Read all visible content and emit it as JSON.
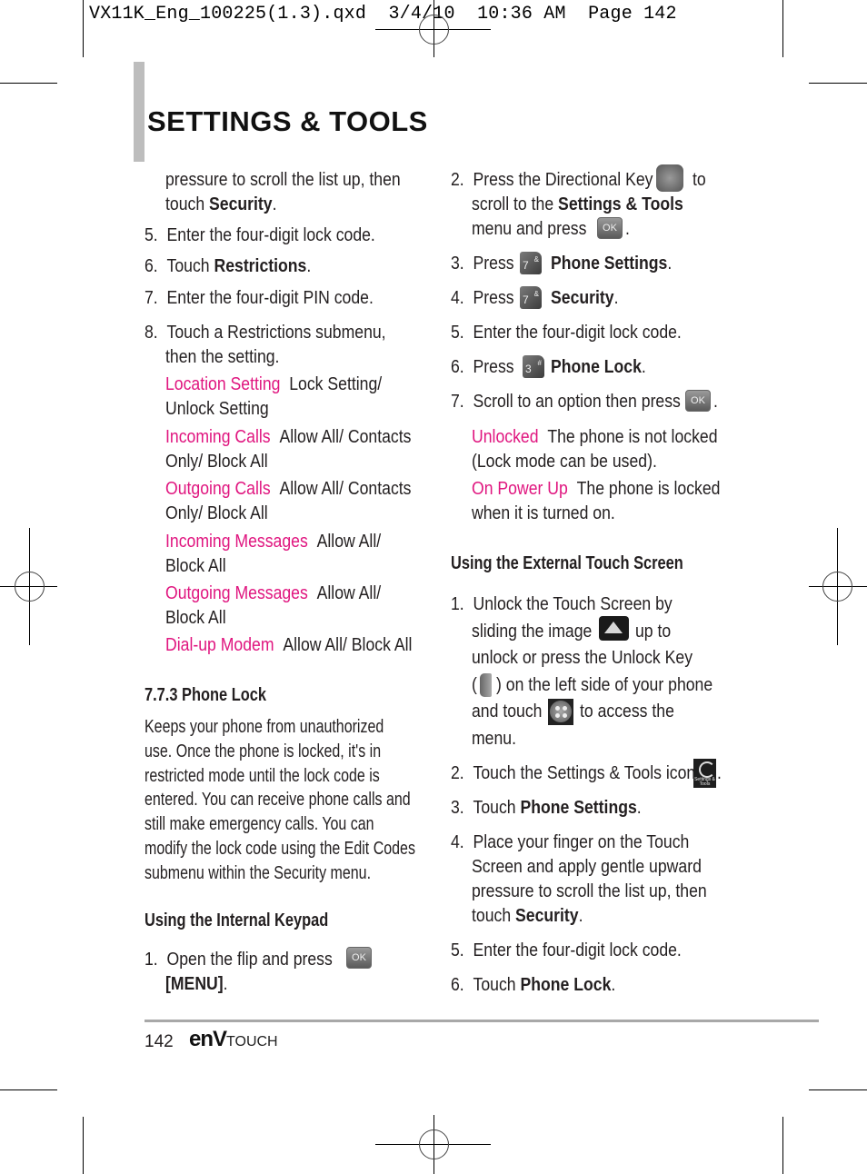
{
  "slug": "VX11K_Eng_100225(1.3).qxd  3/4/10  10:36 AM  Page 142",
  "section_title": "SETTINGS & TOOLS",
  "left": {
    "cont_line1": "pressure to scroll the list up, then",
    "cont_line2_pre": "touch ",
    "cont_line2_bold": "Security",
    "steps": [
      {
        "n": "5.",
        "text": "Enter the four-digit lock code."
      },
      {
        "n": "6.",
        "pre": "Touch ",
        "bold": "Restrictions",
        "post": "."
      },
      {
        "n": "7.",
        "text": "Enter the four-digit PIN code."
      },
      {
        "n": "8.",
        "line1": "Touch a Restrictions submenu,",
        "line2": "then the setting."
      }
    ],
    "options": [
      {
        "name": "Location Setting",
        "l1": "Lock Setting/",
        "l2": "Unlock Setting"
      },
      {
        "name": "Incoming Calls",
        "l1": "Allow All/ Contacts",
        "l2": "Only/ Block All"
      },
      {
        "name": "Outgoing Calls",
        "l1": "Allow All/ Contacts",
        "l2": "Only/ Block All"
      },
      {
        "name": "Incoming Messages",
        "l1": "Allow All/",
        "l2": "Block All"
      },
      {
        "name": "Outgoing Messages",
        "l1": "Allow All/",
        "l2": "Block All"
      },
      {
        "name": "Dial-up Modem",
        "l1": "Allow All/ Block All"
      }
    ],
    "heading_phone_lock": "7.7.3 Phone Lock",
    "phone_lock_body": [
      "Keeps your phone from unauthorized",
      "use. Once the phone is locked, it's in",
      "restricted mode until the lock code is",
      "entered. You can receive phone calls and",
      "still make emergency calls. You can",
      "modify the lock code using the Edit Codes",
      "submenu within the Security menu."
    ],
    "heading_internal": "Using the Internal Keypad",
    "step1": {
      "n": "1.",
      "text": "Open the flip and press",
      "bold": "[MENU]",
      "post": "."
    }
  },
  "right": {
    "steps_a": [
      {
        "n": "2.",
        "l1_pre": "Press the Directional Key",
        "l1_post": "to",
        "l2_pre": "scroll to the ",
        "l2_bold": "Settings & Tools",
        "l3": "menu and press",
        "l3_post": "."
      },
      {
        "n": "3.",
        "pre": "Press",
        "bold": "Phone Settings",
        "post": ".",
        "key": "7",
        "key_sup": "&"
      },
      {
        "n": "4.",
        "pre": "Press",
        "bold": "Security",
        "post": ".",
        "key": "7",
        "key_sup": "&"
      },
      {
        "n": "5.",
        "text": "Enter the four-digit lock code."
      },
      {
        "n": "6.",
        "pre": "Press",
        "bold": "Phone Lock",
        "post": ".",
        "key": "3",
        "key_sup": "#"
      },
      {
        "n": "7.",
        "text": "Scroll to an option then press",
        "post": "."
      }
    ],
    "lock_options": [
      {
        "name": "Unlocked",
        "l1": "The phone is not locked",
        "l2": "(Lock mode can be used)."
      },
      {
        "name": "On Power Up",
        "l1": "The phone is locked",
        "l2": "when it is turned on."
      }
    ],
    "heading_external": "Using the External Touch Screen",
    "steps_b": [
      {
        "n": "1.",
        "lines": [
          "Unlock the Touch Screen by",
          "sliding the image",
          "up to",
          "unlock or press the Unlock Key",
          "(",
          ") on the left side of your phone",
          "and touch",
          "to access the",
          "menu."
        ]
      },
      {
        "n": "2.",
        "text": "Touch the Settings & Tools icon",
        "post": "."
      },
      {
        "n": "3.",
        "pre": "Touch ",
        "bold": "Phone Settings",
        "post": "."
      },
      {
        "n": "4.",
        "lines": [
          "Place your finger on the Touch",
          "Screen and apply gentle upward",
          "pressure to scroll the list up, then"
        ],
        "last_pre": "touch ",
        "last_bold": "Security",
        "post": "."
      },
      {
        "n": "5.",
        "text": "Enter the four-digit lock code."
      },
      {
        "n": "6.",
        "pre": "Touch ",
        "bold": "Phone Lock",
        "post": "."
      }
    ]
  },
  "icons": {
    "ok_label": "OK",
    "settings_icon_text": "Settings & Tools"
  },
  "footer": {
    "page_number": "142",
    "brand_main": "enV",
    "brand_sub": "TOUCH"
  },
  "colors": {
    "accent": "#e0157f",
    "rule": "#a8a8a8",
    "sidebar": "#bdbdbd"
  }
}
